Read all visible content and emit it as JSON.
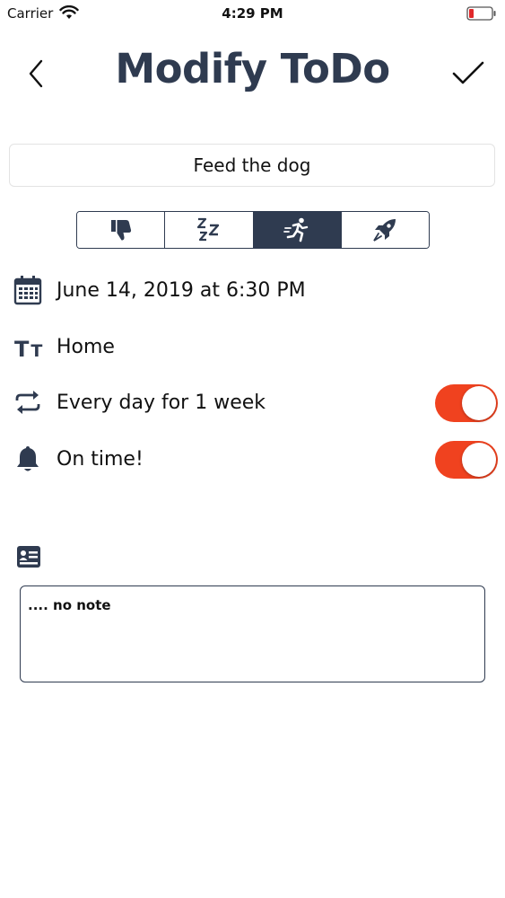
{
  "status_bar": {
    "carrier": "Carrier",
    "time": "4:29 PM",
    "battery_color": "#e0282a"
  },
  "nav": {
    "title": "Modify ToDo",
    "back_icon": "chevron-left-icon",
    "done_icon": "checkmark-icon"
  },
  "task": {
    "name": "Feed the dog"
  },
  "priority_segment": {
    "options": [
      {
        "icon": "thumbs-down-icon",
        "selected": false
      },
      {
        "icon": "snooze-zzz-icon",
        "selected": false
      },
      {
        "icon": "running-person-icon",
        "selected": true
      },
      {
        "icon": "rocket-icon",
        "selected": false
      }
    ]
  },
  "details": {
    "date": "June 14, 2019 at 6:30 PM",
    "category": "Home",
    "repeat": "Every day for 1 week",
    "repeat_enabled": true,
    "alert": "On time!",
    "alert_enabled": true
  },
  "note": {
    "text": ".... no note"
  },
  "colors": {
    "accent": "#2f3b50",
    "toggle_on": "#f0421f"
  }
}
